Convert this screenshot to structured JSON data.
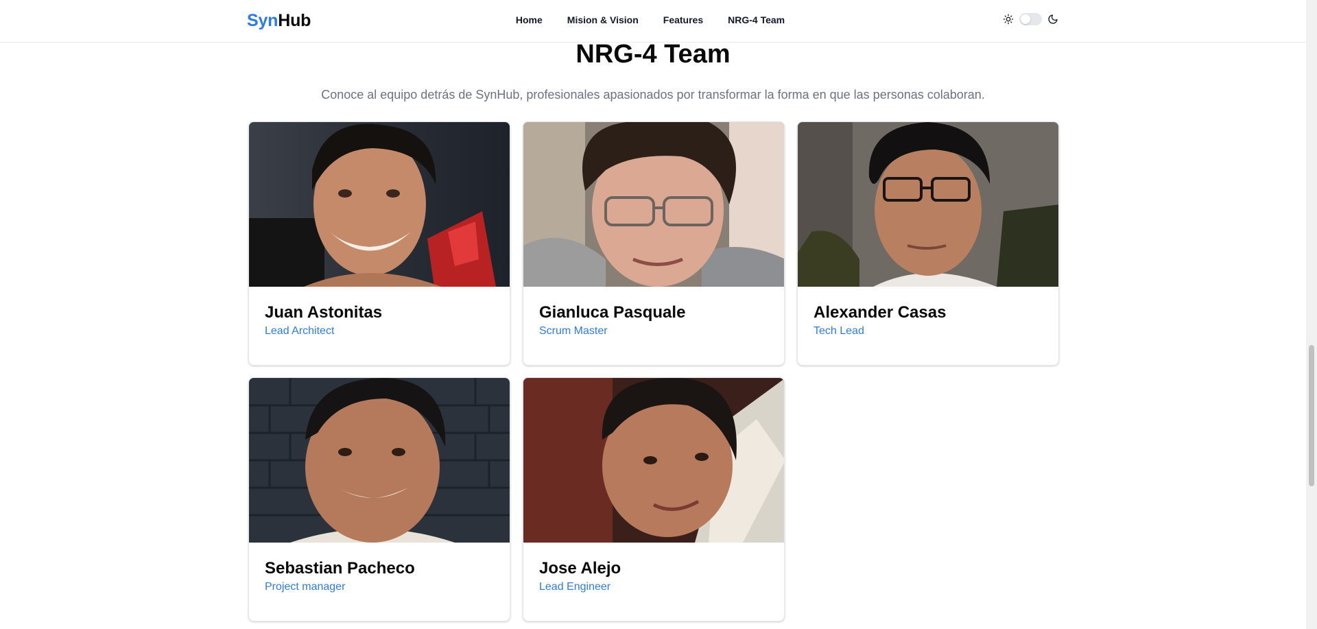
{
  "header": {
    "logo_part1": "Syn",
    "logo_part2": "Hub",
    "nav": [
      "Home",
      "Mision & Vision",
      "Features",
      "NRG-4 Team"
    ],
    "theme_toggle": {
      "icons": [
        "sun-icon",
        "moon-icon"
      ],
      "dark_mode": false
    }
  },
  "section": {
    "title": "NRG-4 Team",
    "subtitle": "Conoce al equipo detrás de SynHub, profesionales apasionados por transformar la forma en que las personas colaboran."
  },
  "members": [
    {
      "name": "Juan Astonitas",
      "role": "Lead Architect"
    },
    {
      "name": "Gianluca Pasquale",
      "role": "Scrum Master"
    },
    {
      "name": "Alexander Casas",
      "role": "Tech Lead"
    },
    {
      "name": "Sebastian Pacheco",
      "role": "Project manager"
    },
    {
      "name": "Jose Alejo",
      "role": "Lead Engineer"
    }
  ],
  "colors": {
    "brand": "#2f7be5",
    "text": "#0a0a0a",
    "muted": "#6b7280"
  }
}
